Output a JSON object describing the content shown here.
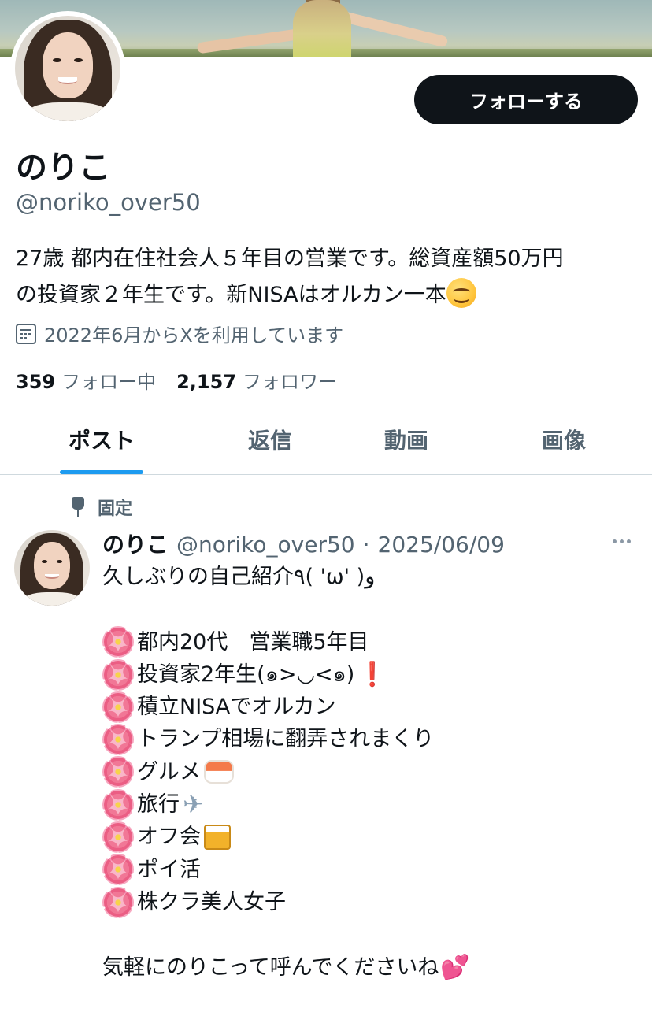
{
  "profile": {
    "display_name": "のりこ",
    "handle": "@noriko_over50",
    "follow_button": "フォローする",
    "bio_line1": "27歳 都内在住社会人５年目の営業です。総資産額50万円",
    "bio_line2": "の投資家２年生です。新NISAはオルカン一本",
    "bio_emoji": "smiling-face-emoji",
    "joined": "2022年6月からXを利用しています",
    "following_count": "359",
    "following_label": "フォロー中",
    "followers_count": "2,157",
    "followers_label": "フォロワー"
  },
  "tabs": [
    {
      "label": "ポスト",
      "active": true
    },
    {
      "label": "返信",
      "active": false
    },
    {
      "label": "動画",
      "active": false
    },
    {
      "label": "画像",
      "active": false
    }
  ],
  "pinned_post": {
    "pinned_label": "固定",
    "author_name": "のりこ",
    "author_handle": "@noriko_over50",
    "separator": "·",
    "date": "2025/06/09",
    "lines": [
      "久しぶりの自己紹介٩( 'ω' )و",
      "都内20代　営業職5年目",
      "投資家2年生(๑>◡<๑)",
      "積立NISAでオルカン",
      "トランプ相場に翻弄されまくり",
      "グルメ",
      "旅行",
      "オフ会",
      "ポイ活",
      "株クラ美人女子",
      "気軽にのりこって呼んでくださいね"
    ],
    "emojis": {
      "flower": "cherry-blossom-emoji",
      "exclamation": "❗",
      "sushi": "sushi-emoji",
      "plane": "✈",
      "beer": "beer-mugs-emoji",
      "hearts": "💕"
    }
  },
  "colors": {
    "text_primary": "#0f1419",
    "text_secondary": "#536471",
    "accent": "#1d9bf0",
    "button_bg": "#0f1419"
  }
}
